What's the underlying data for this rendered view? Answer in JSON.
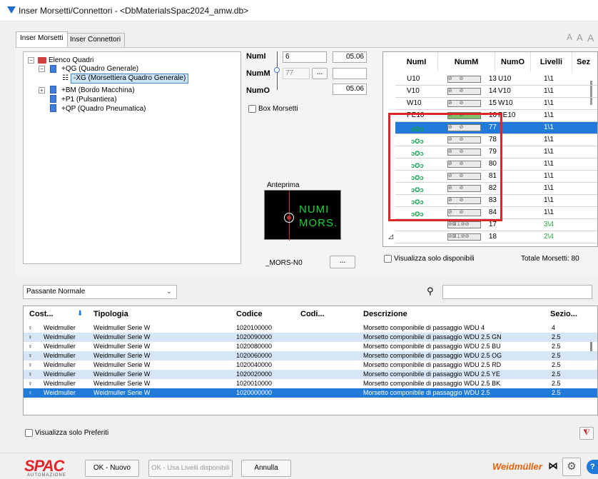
{
  "window": {
    "title": "Inser Morsetti/Connettori - <DbMaterialsSpac2024_amw.db>"
  },
  "tabs": [
    "Inser Morsetti",
    "Inser Connettori"
  ],
  "font_size_letters": [
    "A",
    "A",
    "A"
  ],
  "tree": {
    "root": "Elenco Quadri",
    "nodes": [
      "+QG (Quadro Generale)",
      "-XG (Morsettiera Quadro Generale)",
      "+BM (Bordo Macchina)",
      "+P1 (Pulsantiera)",
      "+QP (Quadro Pneumatica)"
    ]
  },
  "form": {
    "numi_label": "NumI",
    "numi_value": "6",
    "numi_box": "05.06",
    "numm_label": "NumM",
    "numm_value": "77",
    "numm_button": "...",
    "numo_label": "NumO",
    "numo_box": "05.06",
    "box_morsetti": "Box Morsetti"
  },
  "preview": {
    "title": "Anteprima",
    "text_line1": "NUMI",
    "text_line2": "MORS.",
    "name": "_MORS-N0",
    "button": "..."
  },
  "grid": {
    "headers": [
      "NumI",
      "NumM",
      "NumO",
      "Livelli",
      "Sez"
    ],
    "rows": [
      {
        "numi": "U10",
        "numm": "13",
        "numo": "U10",
        "livelli": "1\\1"
      },
      {
        "numi": "V10",
        "numm": "14",
        "numo": "V10",
        "livelli": "1\\1"
      },
      {
        "numi": "W10",
        "numm": "15",
        "numo": "W10",
        "livelli": "1\\1"
      },
      {
        "numi": "PE10",
        "numm": "16",
        "numo": "PE10",
        "livelli": "1\\1"
      },
      {
        "numi": "",
        "numm": "77",
        "numo": "",
        "livelli": "1\\1"
      },
      {
        "numi": "",
        "numm": "78",
        "numo": "",
        "livelli": "1\\1"
      },
      {
        "numi": "",
        "numm": "79",
        "numo": "",
        "livelli": "1\\1"
      },
      {
        "numi": "",
        "numm": "80",
        "numo": "",
        "livelli": "1\\1"
      },
      {
        "numi": "",
        "numm": "81",
        "numo": "",
        "livelli": "1\\1"
      },
      {
        "numi": "",
        "numm": "82",
        "numo": "",
        "livelli": "1\\1"
      },
      {
        "numi": "",
        "numm": "83",
        "numo": "",
        "livelli": "1\\1"
      },
      {
        "numi": "",
        "numm": "84",
        "numo": "",
        "livelli": "1\\1"
      },
      {
        "numi": "",
        "numm": "17",
        "numo": "",
        "livelli": "3\\4"
      },
      {
        "numi": "",
        "numm": "18",
        "numo": "",
        "livelli": "2\\4"
      }
    ],
    "visualizza_disponibili": "Visualizza solo disponibili",
    "totale": "Totale Morsetti: 80"
  },
  "filter": {
    "dropdown": "Passante Normale"
  },
  "articles": {
    "headers": [
      "Cost...",
      "Tipologia",
      "Codice",
      "Codi...",
      "Descrizione",
      "Sezio..."
    ],
    "rows": [
      {
        "cost": "Weidmuller",
        "tip": "Weidmuller Serie W",
        "codice": "1020100000",
        "descr": "Morsetto componibile di passaggio WDU 4",
        "sez": "4"
      },
      {
        "cost": "Weidmuller",
        "tip": "Weidmuller Serie W",
        "codice": "1020090000",
        "descr": "Morsetto componibile di passaggio WDU 2.5 GN",
        "sez": "2.5"
      },
      {
        "cost": "Weidmuller",
        "tip": "Weidmuller Serie W",
        "codice": "1020080000",
        "descr": "Morsetto componibile di passaggio WDU 2.5 BU",
        "sez": "2.5"
      },
      {
        "cost": "Weidmuller",
        "tip": "Weidmuller Serie W",
        "codice": "1020060000",
        "descr": "Morsetto componibile di passaggio WDU 2.5 OG",
        "sez": "2.5"
      },
      {
        "cost": "Weidmuller",
        "tip": "Weidmuller Serie W",
        "codice": "1020040000",
        "descr": "Morsetto componibile di passaggio WDU 2.5 RD",
        "sez": "2.5"
      },
      {
        "cost": "Weidmuller",
        "tip": "Weidmuller Serie W",
        "codice": "1020020000",
        "descr": "Morsetto componibile di passaggio WDU 2.5 YE",
        "sez": "2.5"
      },
      {
        "cost": "Weidmuller",
        "tip": "Weidmuller Serie W",
        "codice": "1020010000",
        "descr": "Morsetto componibile di passaggio WDU 2.5 BK",
        "sez": "2.5"
      },
      {
        "cost": "Weidmuller",
        "tip": "Weidmuller Serie W",
        "codice": "1020000000",
        "descr": "Morsetto componibile di passaggio WDU 2.5",
        "sez": "2.5"
      }
    ],
    "visualizza_preferiti": "Visualizza solo Preferiti"
  },
  "footer": {
    "brand": "SPAC",
    "brand_sub": "AUTOMAZIONE",
    "ok_nuovo": "OK - Nuovo",
    "ok_usa": "OK - Usa Livelli disponibili",
    "annulla": "Annulla",
    "weidmuller": "Weidmüller"
  },
  "colors": {
    "accent": "#1f7bd7",
    "highlight": "#e0252a",
    "row_alt": "#d6e6f6",
    "preview_green": "#19d23a"
  }
}
